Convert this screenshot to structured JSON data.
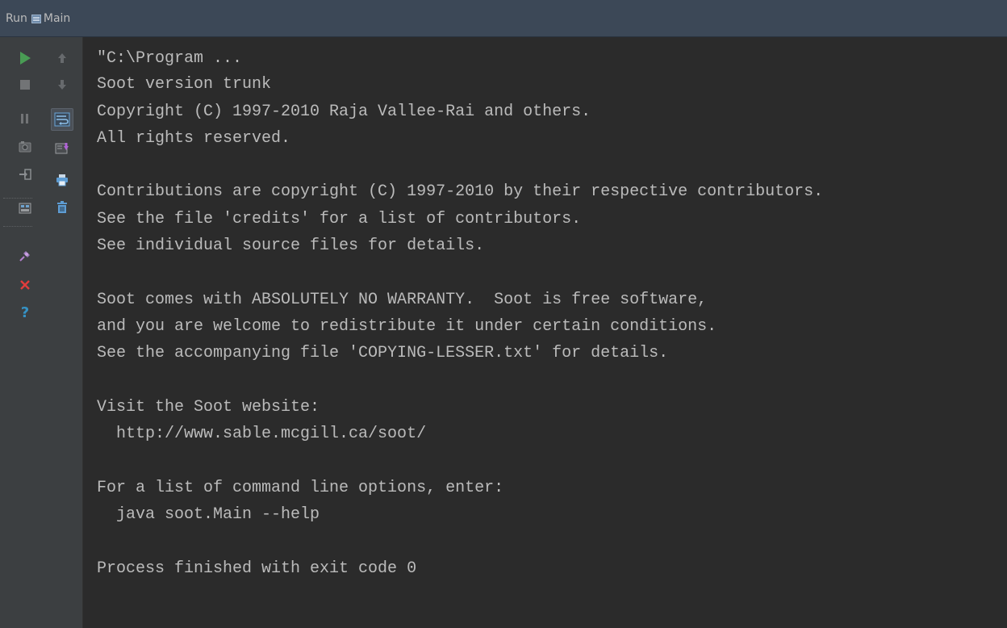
{
  "header": {
    "run_label": "Run",
    "tab_label": "Main"
  },
  "toolbar": {
    "left": [
      {
        "name": "rerun-icon"
      },
      {
        "name": "stop-icon"
      },
      {
        "name": "pause-icon"
      },
      {
        "name": "dump-threads-icon"
      },
      {
        "name": "exit-icon"
      },
      {
        "name": "restore-layout-icon"
      },
      {
        "name": "pin-icon"
      },
      {
        "name": "close-icon"
      },
      {
        "name": "help-icon"
      }
    ],
    "right": [
      {
        "name": "up-arrow-icon"
      },
      {
        "name": "down-arrow-icon"
      },
      {
        "name": "soft-wrap-icon"
      },
      {
        "name": "scroll-to-end-icon"
      },
      {
        "name": "print-icon"
      },
      {
        "name": "clear-all-icon"
      }
    ]
  },
  "console": {
    "lines": [
      "\"C:\\Program ...",
      "Soot version trunk",
      "Copyright (C) 1997-2010 Raja Vallee-Rai and others.",
      "All rights reserved.",
      "",
      "Contributions are copyright (C) 1997-2010 by their respective contributors.",
      "See the file 'credits' for a list of contributors.",
      "See individual source files for details.",
      "",
      "Soot comes with ABSOLUTELY NO WARRANTY.  Soot is free software,",
      "and you are welcome to redistribute it under certain conditions.",
      "See the accompanying file 'COPYING-LESSER.txt' for details.",
      "",
      "Visit the Soot website:",
      "  http://www.sable.mcgill.ca/soot/",
      "",
      "For a list of command line options, enter:",
      "  java soot.Main --help",
      "",
      "Process finished with exit code 0"
    ]
  },
  "colors": {
    "background": "#2b2b2b",
    "text": "#bbbbbb",
    "toolbar": "#3c3f41",
    "header": "#3c4857",
    "run_green": "#499c54",
    "stop_red": "#e03c3c",
    "help_blue": "#3592c4"
  }
}
